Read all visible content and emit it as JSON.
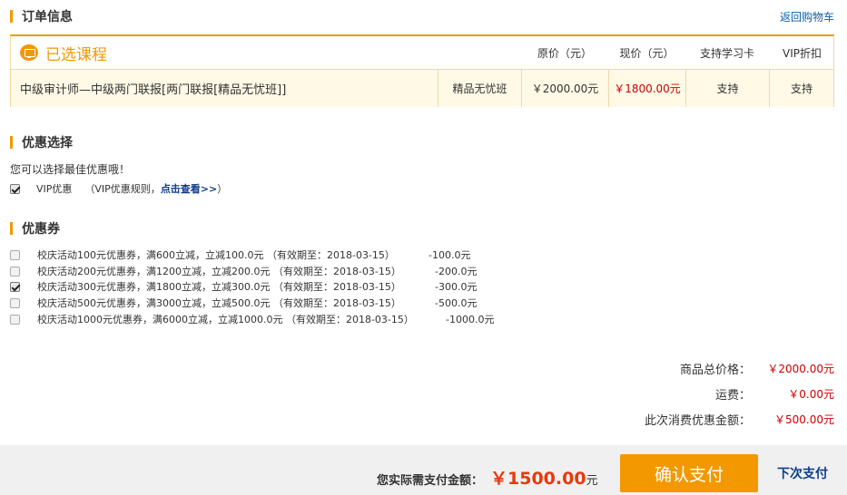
{
  "order_info": {
    "title": "订单信息",
    "back_link": "返回购物车"
  },
  "course_table": {
    "section_label": "已选课程",
    "headers": [
      "原价（元）",
      "现价（元）",
      "支持学习卡",
      "VIP折扣"
    ],
    "row": {
      "name": "中级审计师—中级两门联报[两门联报[精品无忧班]]",
      "type": "精品无忧班",
      "original_price": "￥2000.00元",
      "current_price": "￥1800.00元",
      "study_card": "支持",
      "vip_discount": "支持"
    }
  },
  "discount": {
    "title": "优惠选择",
    "hint": "您可以选择最佳优惠哦！",
    "vip_checked": true,
    "vip_label": "VIP优惠",
    "vip_rule_prefix": "（VIP优惠规则，",
    "vip_rule_link": "点击查看>>",
    "vip_rule_suffix": "）"
  },
  "coupons": {
    "title": "优惠券",
    "items": [
      {
        "text": "校庆活动100元优惠券，满600立减，立减100.0元 （有效期至：2018-03-15）",
        "amount": "-100.0元",
        "checked": false
      },
      {
        "text": "校庆活动200元优惠券，满1200立减，立减200.0元 （有效期至：2018-03-15）",
        "amount": "-200.0元",
        "checked": false
      },
      {
        "text": "校庆活动300元优惠券，满1800立减，立减300.0元 （有效期至：2018-03-15）",
        "amount": "-300.0元",
        "checked": true
      },
      {
        "text": "校庆活动500元优惠券，满3000立减，立减500.0元 （有效期至：2018-03-15）",
        "amount": "-500.0元",
        "checked": false
      },
      {
        "text": "校庆活动1000元优惠券，满6000立减，立减1000.0元 （有效期至：2018-03-15）",
        "amount": "-1000.0元",
        "checked": false
      }
    ]
  },
  "summary": {
    "total_label": "商品总价格：",
    "total_value": "￥2000.00元",
    "shipping_label": "运费：",
    "shipping_value": "￥0.00元",
    "discount_label": "此次消费优惠金额：",
    "discount_value": "￥500.00元"
  },
  "payment": {
    "label": "您实际需支付金额：",
    "amount": "￥1500.00",
    "unit": "元",
    "confirm_button": "确认支付",
    "next_link": "下次支付"
  },
  "colors": {
    "accent": "#f39800",
    "price_red": "#cc0000",
    "link_blue": "#0e3d8a"
  }
}
